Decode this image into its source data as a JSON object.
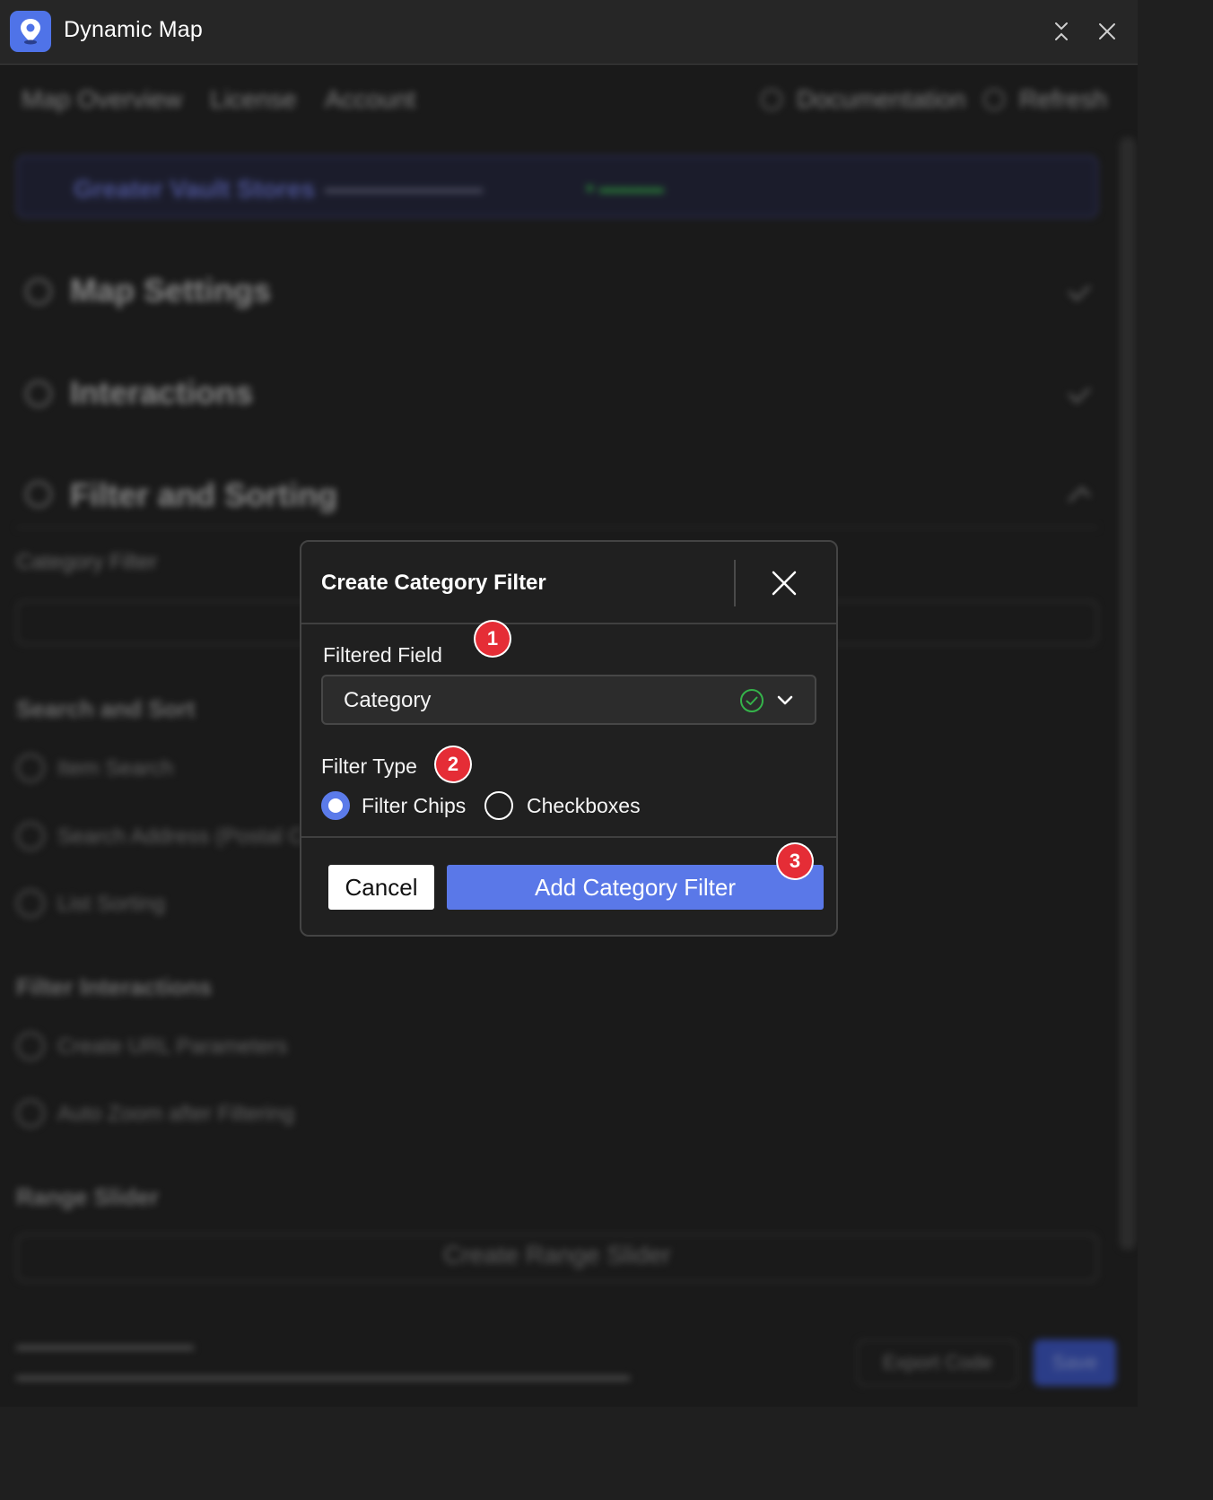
{
  "window": {
    "title": "Dynamic Map"
  },
  "background": {
    "nav_tabs": [
      "Map Overview",
      "License",
      "Account"
    ],
    "nav_right": [
      "Documentation",
      "Refresh"
    ],
    "banner_title": "Greater Vault Stores",
    "sections": [
      "Map Settings",
      "Interactions",
      "Filter and Sorting"
    ],
    "category_filter_label": "Category Filter",
    "search_sort_heading": "Search and Sort",
    "search_sort_items": [
      "Item Search",
      "Search Address (Postal Code)",
      "List Sorting"
    ],
    "filter_interactions_heading": "Filter Interactions",
    "filter_interactions_items": [
      "Create URL Parameters",
      "Auto Zoom after Filtering"
    ],
    "range_slider_heading": "Range Slider",
    "range_slider_button": "Create Range Slider",
    "footer_buttons": [
      "Export Code",
      "Save"
    ]
  },
  "modal": {
    "title": "Create Category Filter",
    "filtered_field_label": "Filtered Field",
    "filtered_field_value": "Category",
    "filter_type_label": "Filter Type",
    "filter_type_options": [
      "Filter Chips",
      "Checkboxes"
    ],
    "filter_type_selected": "Filter Chips",
    "cancel_label": "Cancel",
    "submit_label": "Add Category Filter"
  },
  "step_badges": [
    "1",
    "2",
    "3"
  ],
  "colors": {
    "accent": "#5a78e8",
    "success": "#35b34a",
    "badge": "#e52d36"
  }
}
